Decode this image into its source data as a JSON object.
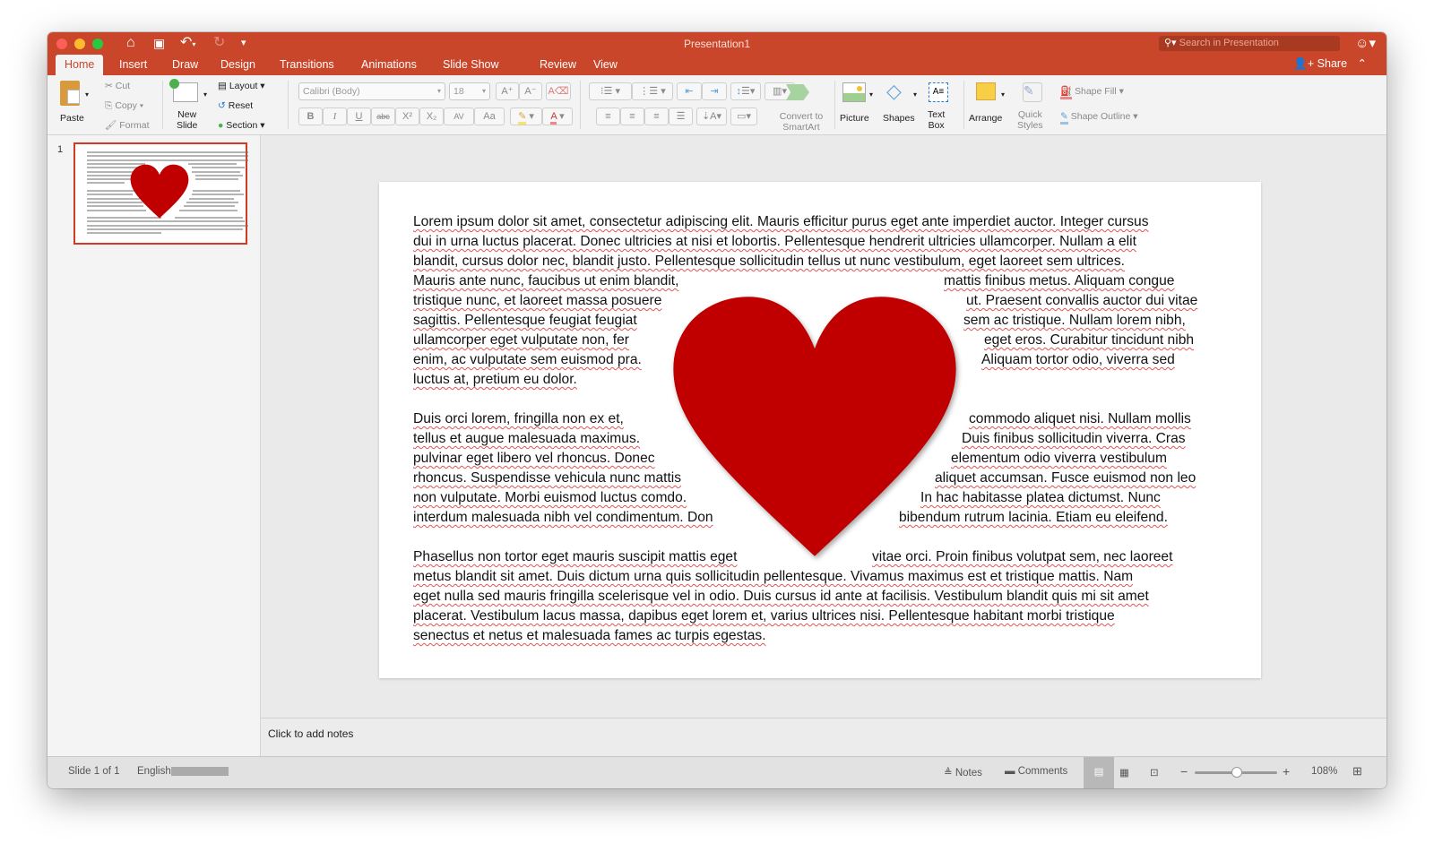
{
  "window": {
    "title": "Presentation1"
  },
  "search": {
    "placeholder": "Search in Presentation"
  },
  "quick_access": {
    "home": "home-icon",
    "save": "save-icon",
    "undo": "undo-icon",
    "redo": "redo-icon",
    "customize": "customize-icon"
  },
  "tabs": [
    "Home",
    "Insert",
    "Draw",
    "Design",
    "Transitions",
    "Animations",
    "Slide Show",
    "Review",
    "View"
  ],
  "active_tab": "Home",
  "share_label": "Share",
  "ribbon": {
    "paste": "Paste",
    "cut": "Cut",
    "copy": "Copy",
    "format": "Format",
    "new_slide": [
      "New",
      "Slide"
    ],
    "layout": "Layout",
    "reset": "Reset",
    "section": "Section",
    "font_name": "Calibri (Body)",
    "font_size": "18",
    "format_buttons": [
      "B",
      "I",
      "U",
      "abc",
      "X²",
      "X₂",
      "AV",
      "Aa"
    ],
    "convert_smartart": [
      "Convert to",
      "SmartArt"
    ],
    "picture": "Picture",
    "shapes": "Shapes",
    "text_box": [
      "Text",
      "Box"
    ],
    "arrange": "Arrange",
    "quick_styles": [
      "Quick",
      "Styles"
    ],
    "shape_fill": "Shape Fill",
    "shape_outline": "Shape Outline"
  },
  "thumbnail": {
    "number": "1"
  },
  "slide": {
    "heart_color": "#c00000",
    "lines": [
      "Lorem ipsum dolor sit amet, consectetur adipiscing elit. Mauris efficitur purus eget ante imperdiet auctor. Integer cursus",
      "dui in urna luctus placerat. Donec ultricies at nisi et lobortis. Pellentesque hendrerit ultricies ullamcorper. Nullam a elit",
      "blandit, cursus dolor nec, blandit justo. Pellentesque sollicitudin tellus ut nunc vestibulum, eget laoreet sem ultrices.",
      "Mauris ante nunc, faucibus ut enim blandit,",
      "mattis finibus metus. Aliquam congue",
      "tristique nunc, et laoreet massa posuere",
      "ut. Praesent convallis auctor dui vitae",
      "sagittis. Pellentesque feugiat feugiat",
      "sem ac tristique. Nullam lorem nibh,",
      "ullamcorper eget vulputate non, fer",
      "eget eros. Curabitur tincidunt nibh",
      "enim, ac vulputate sem euismod pra.",
      "Aliquam tortor odio, viverra sed",
      "luctus at, pretium eu dolor.",
      "Duis orci lorem, fringilla non ex et,",
      "commodo aliquet nisi. Nullam mollis",
      "tellus et augue malesuada maximus.",
      "Duis finibus sollicitudin viverra. Cras",
      "pulvinar eget libero vel rhoncus. Donec",
      "elementum odio viverra vestibulum",
      "rhoncus. Suspendisse vehicula nunc mattis",
      "aliquet accumsan. Fusce euismod non leo",
      "non vulputate. Morbi euismod luctus comdo.",
      "In hac habitasse platea dictumst. Nunc",
      "interdum malesuada nibh vel condimentum. Don",
      "bibendum rutrum lacinia. Etiam eu eleifend.",
      "Phasellus non tortor eget mauris suscipit mattis   eget",
      "vitae orci. Proin finibus volutpat sem, nec laoreet",
      "metus blandit sit amet. Duis dictum urna quis sollicitudin pellentesque. Vivamus maximus est et tristique mattis. Nam",
      "eget nulla sed mauris fringilla scelerisque vel in odio. Duis cursus id ante at facilisis. Vestibulum blandit quis mi sit amet",
      "placerat. Vestibulum lacus massa, dapibus eget lorem et, varius ultrices nisi. Pellentesque habitant morbi tristique",
      "senectus et netus et malesuada fames ac turpis egestas."
    ]
  },
  "notes": {
    "placeholder": "Click to add notes"
  },
  "status": {
    "slide_counter": "Slide 1 of 1",
    "language": "English",
    "notes": "Notes",
    "comments": "Comments",
    "zoom_percent": 108,
    "zoom_label": "108%"
  }
}
